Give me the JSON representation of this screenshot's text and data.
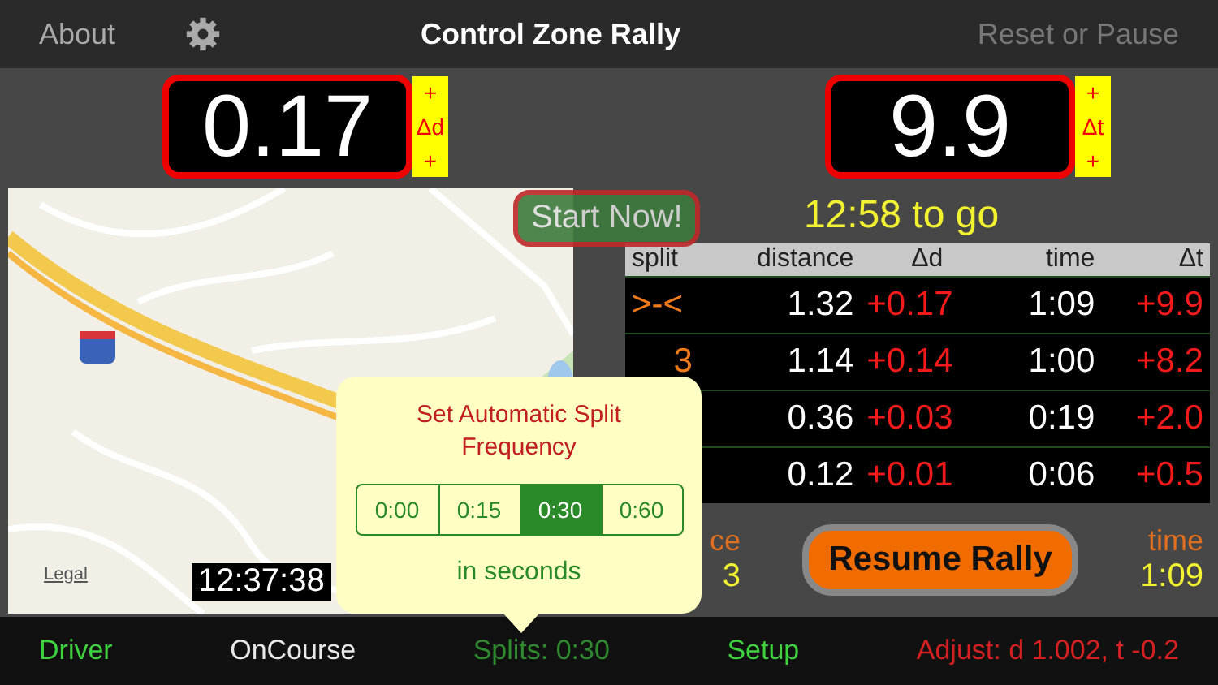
{
  "nav": {
    "left": "About",
    "title": "Control Zone Rally",
    "right": "Reset or Pause"
  },
  "displays": [
    {
      "value": "0.17",
      "side": [
        "+",
        "Δd",
        "+"
      ]
    },
    {
      "value": "9.9",
      "side": [
        "+",
        "Δt",
        "+"
      ]
    }
  ],
  "start_button": "Start Now!",
  "countdown": "12:58 to go",
  "map": {
    "legal": "Legal",
    "clock": "12:37:38"
  },
  "table": {
    "columns": [
      "split",
      "distance",
      "Δd",
      "time",
      "Δt"
    ],
    "rows": [
      {
        "split": ">-<",
        "distance": "1.32",
        "dd": "+0.17",
        "time": "1:09",
        "dt": "+9.9"
      },
      {
        "split": "3",
        "distance": "1.14",
        "dd": "+0.14",
        "time": "1:00",
        "dt": "+8.2"
      },
      {
        "distance": "0.36",
        "dd": "+0.03",
        "time": "0:19",
        "dt": "+2.0"
      },
      {
        "distance": "0.12",
        "dd": "+0.01",
        "time": "0:06",
        "dt": "+0.5"
      }
    ]
  },
  "summary": {
    "distance_label": "ce",
    "distance_value": "3",
    "time_label": "time",
    "time_value": "1:09"
  },
  "resume_button": "Resume Rally",
  "popover": {
    "title": "Set Automatic Split Frequency",
    "options": [
      {
        "label": "0:00",
        "selected": false
      },
      {
        "label": "0:15",
        "selected": false
      },
      {
        "label": "0:30",
        "selected": true
      },
      {
        "label": "0:60",
        "selected": false
      }
    ],
    "caption": "in seconds"
  },
  "tabs": [
    {
      "label": "Driver",
      "color": "#3fd23f"
    },
    {
      "label": "OnCourse",
      "color": "#e8e8e8"
    },
    {
      "label": "Splits: 0:30",
      "color": "#2f8a2f"
    },
    {
      "label": "Setup",
      "color": "#3fd23f"
    },
    {
      "label": "Adjust: d 1.002, t -0.2",
      "color": "#d42020"
    }
  ]
}
